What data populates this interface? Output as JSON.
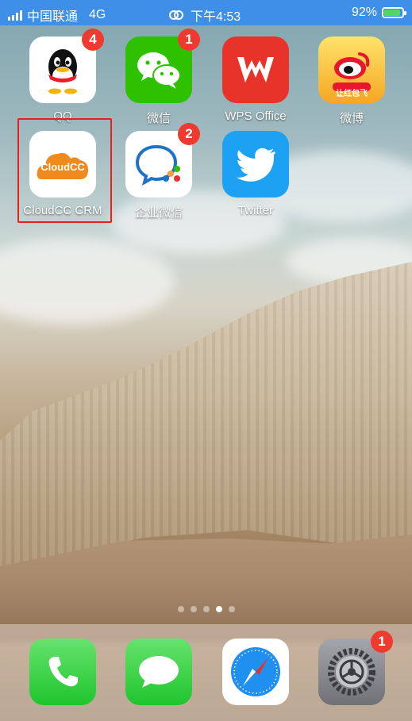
{
  "status_bar": {
    "carrier": "中国联通",
    "network": "4G",
    "time": "下午4:53",
    "battery_percent": "92%"
  },
  "apps": [
    {
      "name": "QQ",
      "badge": "4"
    },
    {
      "name": "微信",
      "badge": "1"
    },
    {
      "name": "WPS Office",
      "badge": ""
    },
    {
      "name": "微博",
      "badge": ""
    },
    {
      "name": "CloudCC CRM",
      "badge": ""
    },
    {
      "name": "企业微信",
      "badge": "2"
    },
    {
      "name": "Twitter",
      "badge": ""
    }
  ],
  "icon_text": {
    "cloudcc": "CloudCC",
    "weibo": "让红包飞"
  },
  "page_dots": {
    "count": 5,
    "active_index": 3
  },
  "dock": [
    {
      "name": "phone",
      "badge": ""
    },
    {
      "name": "messages",
      "badge": ""
    },
    {
      "name": "safari",
      "badge": ""
    },
    {
      "name": "settings",
      "badge": "1"
    }
  ],
  "colors": {
    "status_bar": "#3d8fe8",
    "badge": "#ef3b2f",
    "highlight_box": "#e42020"
  }
}
